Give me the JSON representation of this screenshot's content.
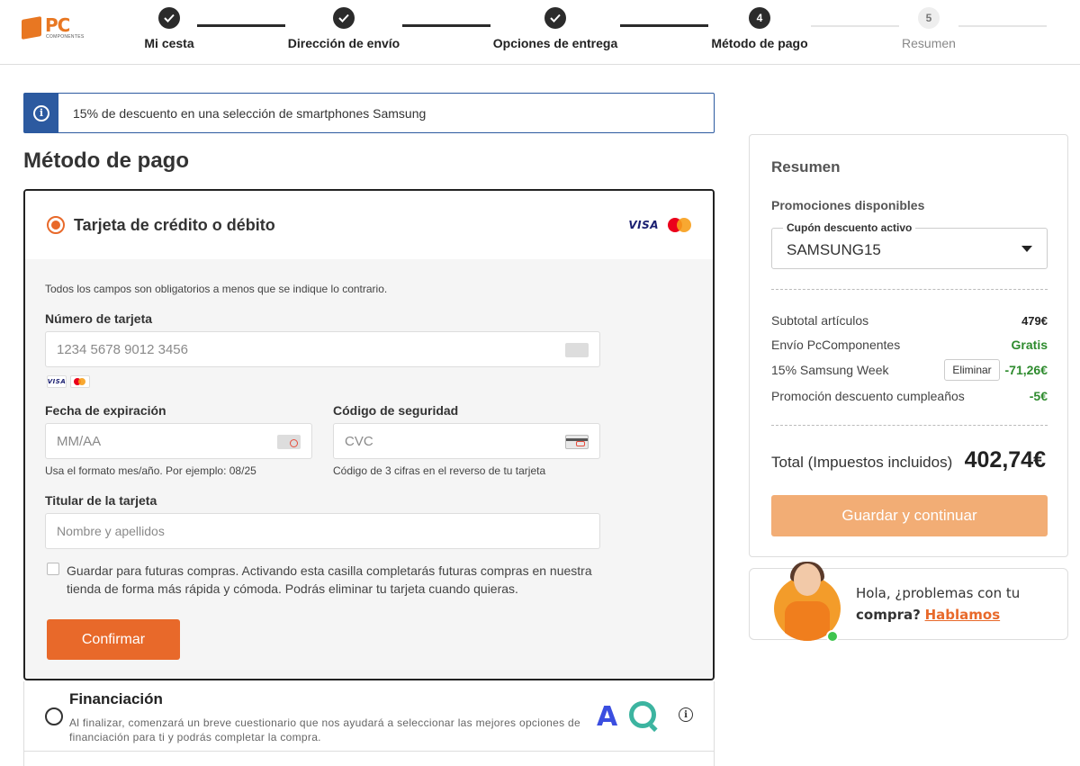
{
  "brand": {
    "logo_text": "PC",
    "logo_sub": "COMPONENTES"
  },
  "stepper": [
    {
      "label": "Mi cesta",
      "state": "done",
      "number": ""
    },
    {
      "label": "Dirección de envío",
      "state": "done",
      "number": ""
    },
    {
      "label": "Opciones de entrega",
      "state": "done",
      "number": ""
    },
    {
      "label": "Método de pago",
      "state": "active",
      "number": "4"
    },
    {
      "label": "Resumen",
      "state": "future",
      "number": "5"
    }
  ],
  "banner": {
    "icon": "info-icon",
    "text": "15% de descuento en una selección de smartphones Samsung"
  },
  "page_title": "Método de pago",
  "card_payment": {
    "title": "Tarjeta de crédito o débito",
    "brand_visa": "VISA",
    "required_note": "Todos los campos son obligatorios a menos que se indique lo contrario.",
    "card_number": {
      "label": "Número de tarjeta",
      "placeholder": "1234 5678 9012 3456"
    },
    "expiry": {
      "label": "Fecha de expiración",
      "placeholder": "MM/AA",
      "hint": "Usa el formato mes/año. Por ejemplo: 08/25"
    },
    "cvc": {
      "label": "Código de seguridad",
      "placeholder": "CVC",
      "hint": "Código de 3 cifras en el reverso de tu tarjeta"
    },
    "holder": {
      "label": "Titular de la tarjeta",
      "placeholder": "Nombre y apellidos"
    },
    "save_text": "Guardar para futuras compras. Activando esta casilla completarás futuras compras en nuestra tienda de forma más rápida y cómoda. Podrás eliminar tu tarjeta cuando quieras.",
    "confirm_label": "Confirmar"
  },
  "financing": {
    "title": "Financiación",
    "description": "Al finalizar, comenzará un breve cuestionario que nos ayudará a seleccionar las mejores opciones de financiación para ti y podrás completar la compra.",
    "provider_a": "A",
    "info_glyph": "i"
  },
  "summary": {
    "title": "Resumen",
    "promotions_label": "Promociones disponibles",
    "coupon_legend": "Cupón descuento activo",
    "coupon_value": "SAMSUNG15",
    "rows": [
      {
        "label": "Subtotal artículos",
        "value": "479€"
      },
      {
        "label": "Envío PcComponentes",
        "value": "Gratis"
      },
      {
        "label": "15% Samsung Week",
        "value": "-71,26€",
        "action": "Eliminar"
      },
      {
        "label": "Promoción descuento cumpleaños",
        "value": "-5€"
      }
    ],
    "total_label": "Total (Impuestos incluidos)",
    "total_value": "402,74€",
    "save_button": "Guardar y continuar"
  },
  "help": {
    "line1": "Hola, ¿problemas con tu",
    "line2_bold": "compra?",
    "link": "Hablamos"
  },
  "colors": {
    "accent": "#e8692a",
    "accent_disabled": "#f2ad75",
    "info_blue": "#2c5aa0",
    "green": "#2e8b2e"
  }
}
